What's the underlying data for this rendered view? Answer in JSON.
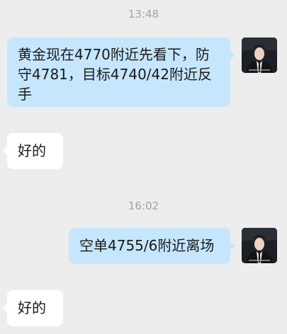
{
  "messages": [
    {
      "type": "timestamp",
      "text": "13:48"
    },
    {
      "type": "outgoing",
      "text": "黄金现在4770附近先看下，防守4781，目标4740/42附近反手"
    },
    {
      "type": "incoming",
      "text": "好的"
    },
    {
      "type": "timestamp",
      "text": "16:02"
    },
    {
      "type": "outgoing",
      "text": "空单4755/6附近离场"
    },
    {
      "type": "incoming",
      "text": "好的"
    }
  ],
  "colors": {
    "background": "#ededed",
    "outgoing_bubble": "#c5e6fd",
    "incoming_bubble": "#ffffff",
    "timestamp_text": "#a3a3a3"
  }
}
